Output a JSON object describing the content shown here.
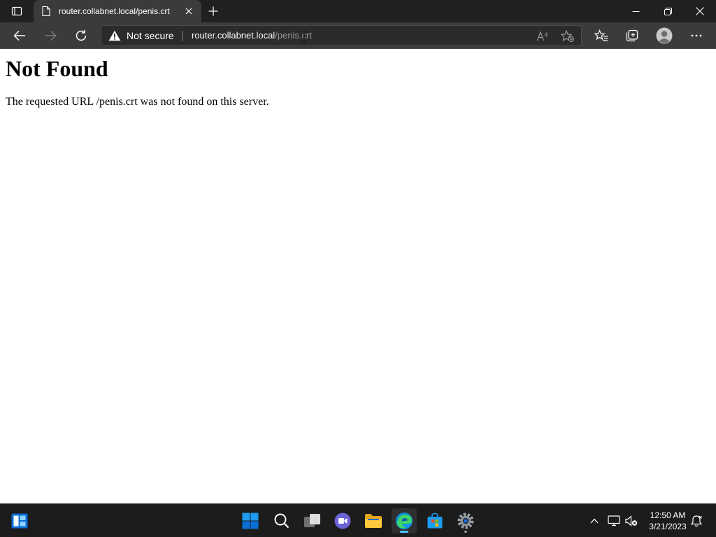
{
  "browser": {
    "tab": {
      "title": "router.collabnet.local/penis.crt"
    },
    "toolbar": {
      "security_label": "Not secure",
      "url_host": "router.collabnet.local",
      "url_path": "/penis.crt"
    }
  },
  "page": {
    "heading": "Not Found",
    "message": "The requested URL /penis.crt was not found on this server."
  },
  "taskbar": {
    "apps": [
      {
        "name": "start-icon"
      },
      {
        "name": "search-icon"
      },
      {
        "name": "task-view-icon"
      },
      {
        "name": "chat-icon"
      },
      {
        "name": "file-explorer-icon"
      },
      {
        "name": "edge-icon",
        "active": true
      },
      {
        "name": "store-icon"
      },
      {
        "name": "settings-icon"
      }
    ],
    "clock": {
      "time": "12:50 AM",
      "date": "3/21/2023"
    }
  },
  "colors": {
    "titlebar_bg": "#202020",
    "toolbar_bg": "#3b3b3b",
    "addressbar_bg": "#2b2b2b",
    "taskbar_bg": "#1c1c1c",
    "accent": "#4cc2ff"
  }
}
